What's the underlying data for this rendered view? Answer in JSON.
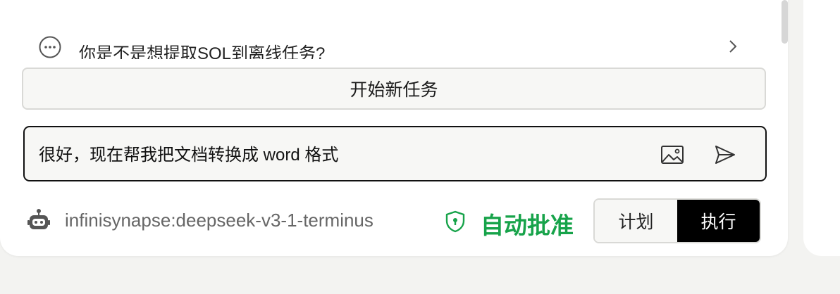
{
  "suggestion": {
    "text": "你是不是想提取SQL到离线任务?",
    "icon": "chat-dots-icon"
  },
  "new_task_button": {
    "label": "开始新任务"
  },
  "chat_input": {
    "value": "很好，现在帮我把文档转换成 word 格式",
    "image_icon": "image-icon",
    "send_icon": "send-icon"
  },
  "footer": {
    "model_icon": "robot-icon",
    "model_name": "infinisynapse:deepseek-v3-1-terminus",
    "approval_icon": "shield-icon",
    "auto_approve_label": "自动批准",
    "auto_approve_color": "#17a34a",
    "modes": [
      {
        "label": "计划",
        "active": false
      },
      {
        "label": "执行",
        "active": true
      }
    ]
  }
}
